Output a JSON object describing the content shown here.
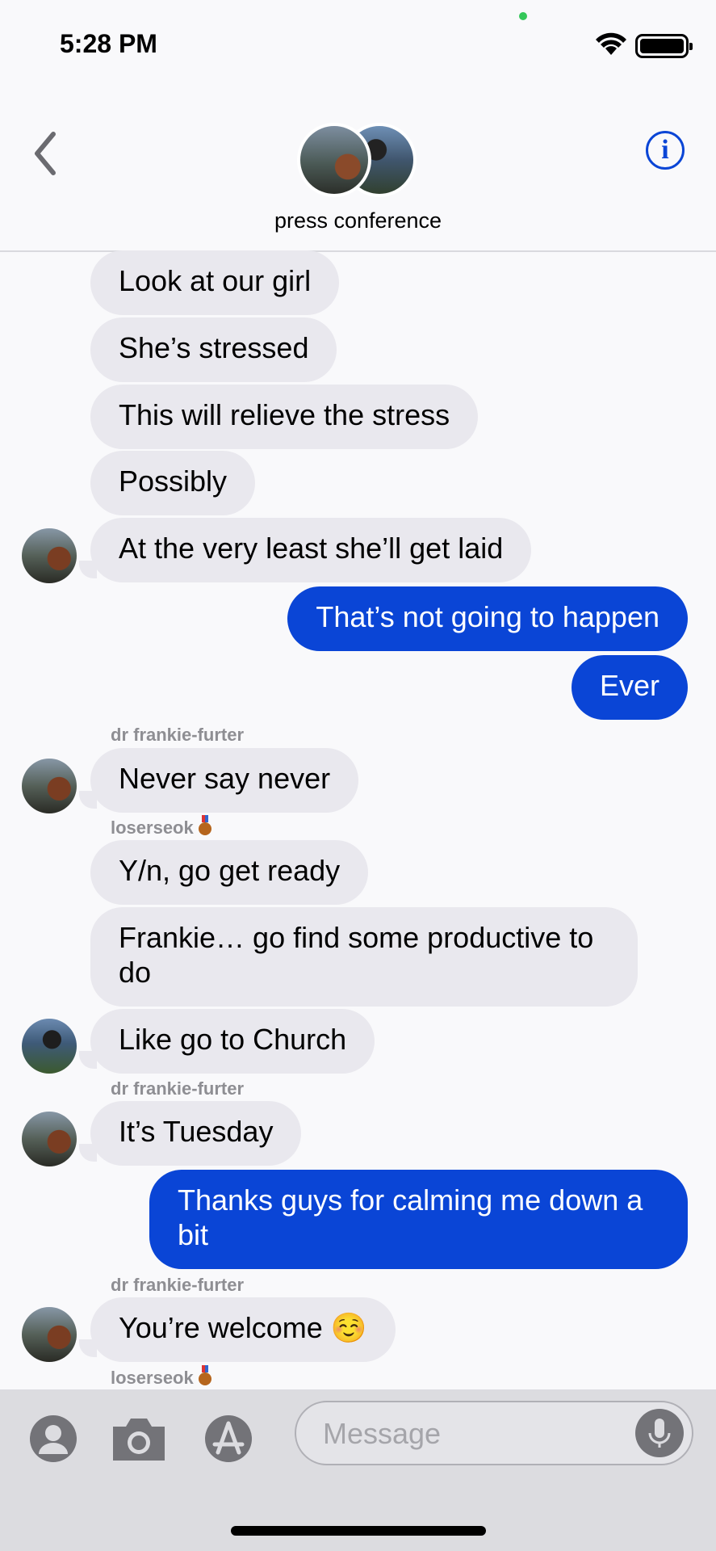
{
  "status_bar": {
    "time": "5:28 PM"
  },
  "header": {
    "group_name": "press conference",
    "info_label": "i"
  },
  "messages": [
    {
      "text": "Look at our girl"
    },
    {
      "text": "She’s stressed"
    },
    {
      "text": "This will relieve the stress"
    },
    {
      "text": "Possibly"
    },
    {
      "text": "At the very least she’ll get laid"
    },
    {
      "text": "That’s not going to happen"
    },
    {
      "text": "Ever"
    },
    {
      "sender": "dr frankie-furter",
      "text": "Never say never"
    },
    {
      "sender": "loserseok",
      "text": "Y/n, go get ready"
    },
    {
      "text": "Frankie… go find some productive to do"
    },
    {
      "text": "Like go to Church"
    },
    {
      "sender": "dr frankie-furter",
      "text": "It’s Tuesday"
    },
    {
      "text": "Thanks guys for calming me down a bit"
    },
    {
      "sender": "dr frankie-furter",
      "text": "You’re welcome ☺️"
    },
    {
      "sender": "loserseok"
    }
  ],
  "composer": {
    "placeholder": "Message"
  },
  "colors": {
    "outgoing": "#0a45d6",
    "incoming": "#e9e8ee",
    "accent": "#0a45d6"
  }
}
